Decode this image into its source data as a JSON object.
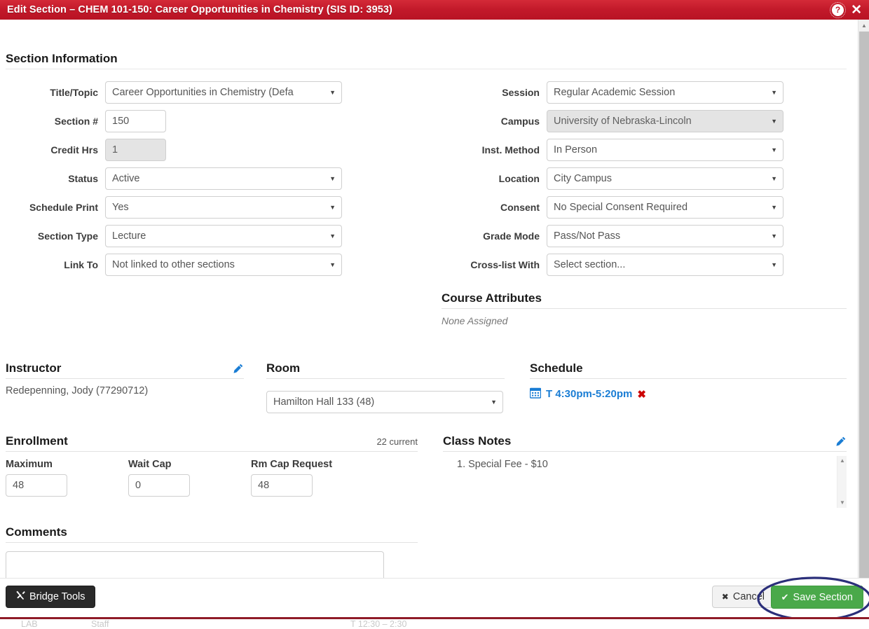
{
  "titlebar": {
    "title": "Edit Section – CHEM 101-150: Career Opportunities in Chemistry (SIS ID: 3953)",
    "help_label": "?",
    "close_label": "✕",
    "background_color": "#c0182a"
  },
  "page": {
    "section_information_heading": "Section Information"
  },
  "left_form": [
    {
      "label": "Title/Topic",
      "value": "Career Opportunities in Chemistry (Defa",
      "type": "select",
      "disabled": false
    },
    {
      "label": "Section #",
      "value": "150",
      "type": "input",
      "disabled": false
    },
    {
      "label": "Credit Hrs",
      "value": "1",
      "type": "input",
      "disabled": true
    },
    {
      "label": "Status",
      "value": "Active",
      "type": "select",
      "disabled": false
    },
    {
      "label": "Schedule Print",
      "value": "Yes",
      "type": "select",
      "disabled": false
    },
    {
      "label": "Section Type",
      "value": "Lecture",
      "type": "select",
      "disabled": false
    },
    {
      "label": "Link To",
      "value": "Not linked to other sections",
      "type": "select",
      "disabled": false
    }
  ],
  "right_form": [
    {
      "label": "Session",
      "value": "Regular Academic Session",
      "type": "select",
      "disabled": false
    },
    {
      "label": "Campus",
      "value": "University of Nebraska-Lincoln",
      "type": "select",
      "disabled": true
    },
    {
      "label": "Inst. Method",
      "value": "In Person",
      "type": "select",
      "disabled": false
    },
    {
      "label": "Location",
      "value": "City Campus",
      "type": "select",
      "disabled": false
    },
    {
      "label": "Consent",
      "value": "No Special Consent Required",
      "type": "select",
      "disabled": false
    },
    {
      "label": "Grade Mode",
      "value": "Pass/Not Pass",
      "type": "select",
      "disabled": false
    },
    {
      "label": "Cross-list With",
      "value": "Select section...",
      "type": "select",
      "disabled": false
    }
  ],
  "course_attributes": {
    "heading": "Course Attributes",
    "empty_text": "None Assigned"
  },
  "instructor": {
    "heading": "Instructor",
    "name": "Redepenning, Jody (77290712)",
    "edit_icon": "pencil-icon"
  },
  "room": {
    "heading": "Room",
    "value": "Hamilton Hall 133 (48)"
  },
  "schedule": {
    "heading": "Schedule",
    "meeting": "T 4:30pm-5:20pm",
    "calendar_icon": "calendar-icon",
    "remove_icon": "✖",
    "link_color": "#1a7dd4",
    "remove_color": "#cc0000"
  },
  "enrollment": {
    "heading": "Enrollment",
    "current_label": "22 current",
    "fields": [
      {
        "label": "Maximum",
        "value": "48"
      },
      {
        "label": "Wait Cap",
        "value": "0"
      },
      {
        "label": "Rm Cap Request",
        "value": "48"
      }
    ]
  },
  "class_notes": {
    "heading": "Class Notes",
    "edit_icon": "pencil-icon",
    "items": [
      "1. Special Fee - $10"
    ]
  },
  "comments": {
    "heading": "Comments",
    "value": "",
    "placeholder": ""
  },
  "footer": {
    "bridge_tools_label": "Bridge Tools",
    "bridge_tools_icon": "tools-icon",
    "cancel_label": "Cancel",
    "cancel_icon": "✖",
    "save_label": "Save Section",
    "save_icon": "✔",
    "save_color": "#4aa94a",
    "highlight_color": "#2b2f7a"
  },
  "background_peek": {
    "col1": "LAB",
    "col2": "Staff",
    "col3": "T 12:30 – 2:30"
  }
}
